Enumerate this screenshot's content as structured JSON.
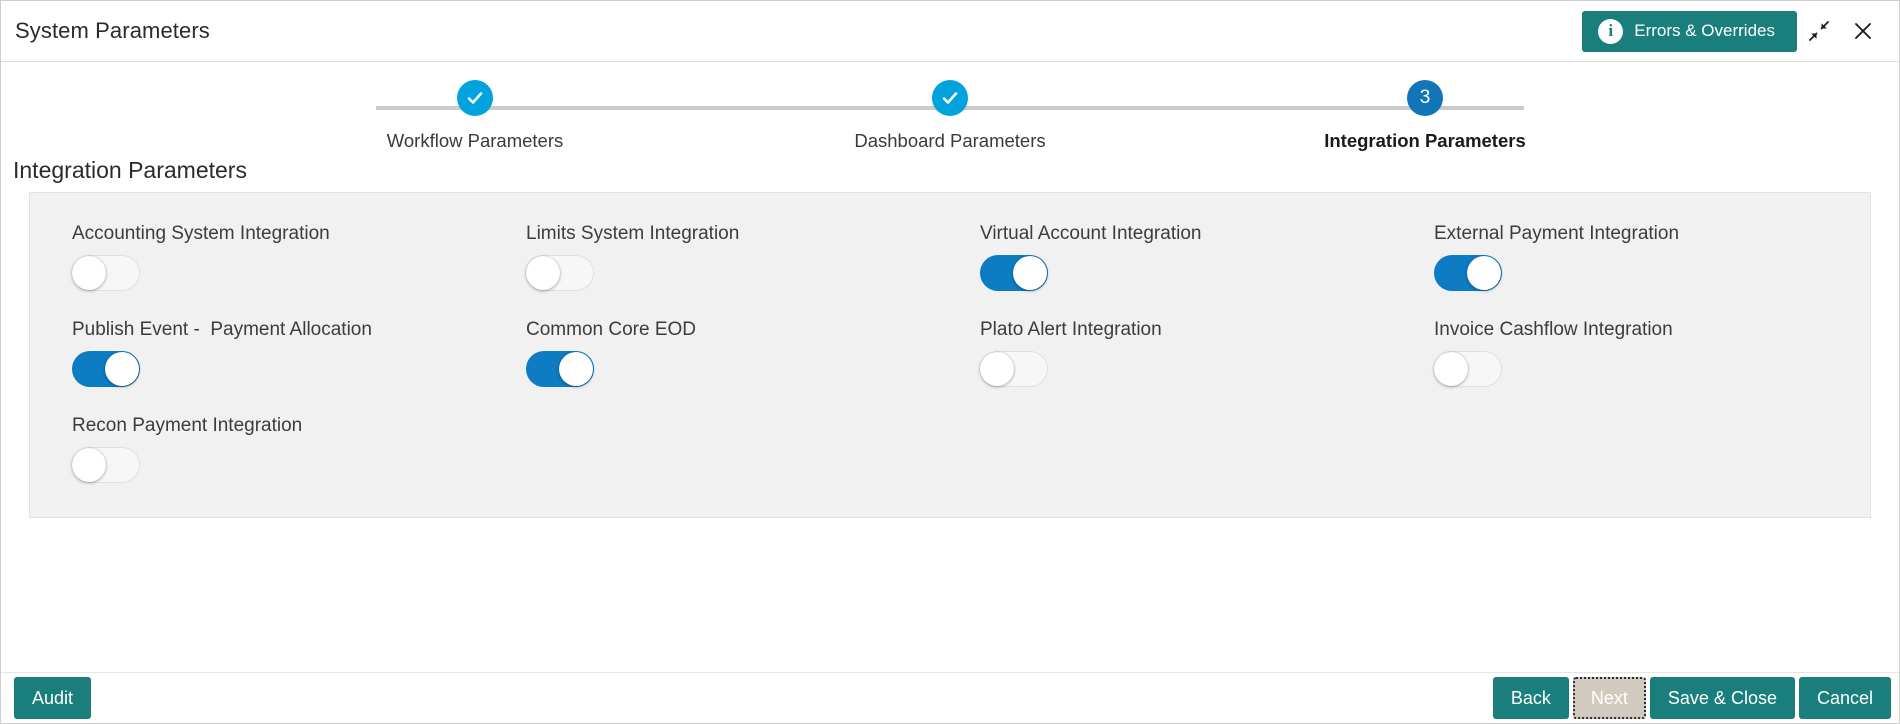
{
  "window": {
    "title": "System Parameters",
    "errors_button_label": "Errors & Overrides",
    "info_icon": "info-icon",
    "minimize_icon": "collapse-arrows-icon",
    "close_icon": "close-icon"
  },
  "colors": {
    "teal": "#1a7f7c",
    "toggle_on_blue": "#0d7cc2",
    "step_done_blue": "#00a3dd",
    "step_active_blue": "#1275b8",
    "panel_gray": "#f1f1f1",
    "disabled_button": "#d3cabf"
  },
  "stepper": {
    "steps": [
      {
        "label": "Workflow Parameters",
        "state": "done",
        "marker": "check"
      },
      {
        "label": "Dashboard Parameters",
        "state": "done",
        "marker": "check"
      },
      {
        "label": "Integration Parameters",
        "state": "active",
        "marker": "3"
      }
    ]
  },
  "section": {
    "title": "Integration Parameters",
    "fields": [
      {
        "label": "Accounting System Integration",
        "state": "off"
      },
      {
        "label": "Limits System Integration",
        "state": "off"
      },
      {
        "label": "Virtual Account Integration",
        "state": "on"
      },
      {
        "label": "External Payment Integration",
        "state": "on"
      },
      {
        "label": "Publish Event -  Payment Allocation",
        "state": "on"
      },
      {
        "label": "Common Core EOD",
        "state": "on"
      },
      {
        "label": "Plato Alert Integration",
        "state": "off"
      },
      {
        "label": "Invoice Cashflow Integration",
        "state": "off"
      },
      {
        "label": "Recon Payment Integration",
        "state": "off"
      }
    ]
  },
  "footer": {
    "audit_label": "Audit",
    "back_label": "Back",
    "next_label": "Next",
    "next_disabled": true,
    "save_close_label": "Save & Close",
    "cancel_label": "Cancel"
  }
}
